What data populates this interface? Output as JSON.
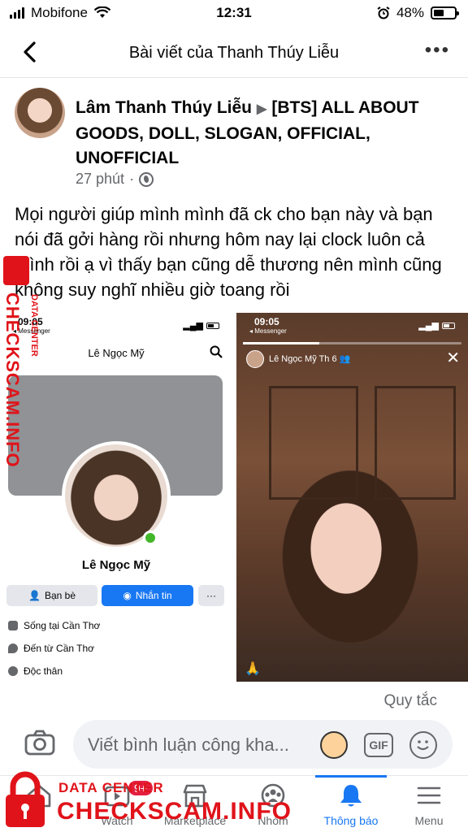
{
  "status_bar": {
    "carrier": "Mobifone",
    "time": "12:31",
    "battery": "48%"
  },
  "header": {
    "title": "Bài viết của Thanh Thúy Liễu"
  },
  "post": {
    "author": "Lâm Thanh Thúy Liễu",
    "group": "[BTS] ALL ABOUT GOODS, DOLL, SLOGAN, OFFICIAL, UNOFFICIAL",
    "time": "27 phút",
    "body": "Mọi người giúp mình mình đã ck cho bạn này và bạn nói đã gởi hàng rồi nhưng hôm nay lại clock luôn cả mình rồi ạ vì thấy bạn cũng dễ thương nên mình cũng không suy nghĩ nhiều giờ toang rồi"
  },
  "image_left": {
    "time": "09:05",
    "app": "Messenger",
    "top_name": "Lê Ngọc Mỹ",
    "name": "Lê Ngọc Mỹ",
    "friends_label": "Bạn bè",
    "message_label": "Nhắn tin",
    "more_label": "···",
    "info": [
      "Sống tại Cần Thơ",
      "Đến từ Cần Thơ",
      "Độc thân"
    ]
  },
  "image_right": {
    "time": "09:05",
    "app": "Messenger",
    "story_name": "Lê Ngọc Mỹ",
    "story_time": "Th 6",
    "story_progress": 0.35
  },
  "rules_label": "Quy tắc",
  "comment": {
    "placeholder": "Viết bình luận công kha...",
    "gif_label": "GIF"
  },
  "bottom_nav": [
    {
      "label": "tin",
      "icon": "home-icon"
    },
    {
      "label": "Watch",
      "icon": "watch-icon",
      "badge": "9+"
    },
    {
      "label": "Marketplace",
      "icon": "marketplace-icon"
    },
    {
      "label": "Nhóm",
      "icon": "groups-icon"
    },
    {
      "label": "Thông báo",
      "icon": "bell-icon",
      "active": true
    },
    {
      "label": "Menu",
      "icon": "menu-icon"
    }
  ],
  "watermark": {
    "side_big": "CHECKSCAM.INFO",
    "side_small": "DATA CENTER",
    "bottom_small": "DATA CENTER",
    "bottom_big": "CHECKSCAM.INFO"
  },
  "colors": {
    "accent": "#1877f2",
    "watermark": "#e0131a",
    "online": "#42b72a"
  }
}
